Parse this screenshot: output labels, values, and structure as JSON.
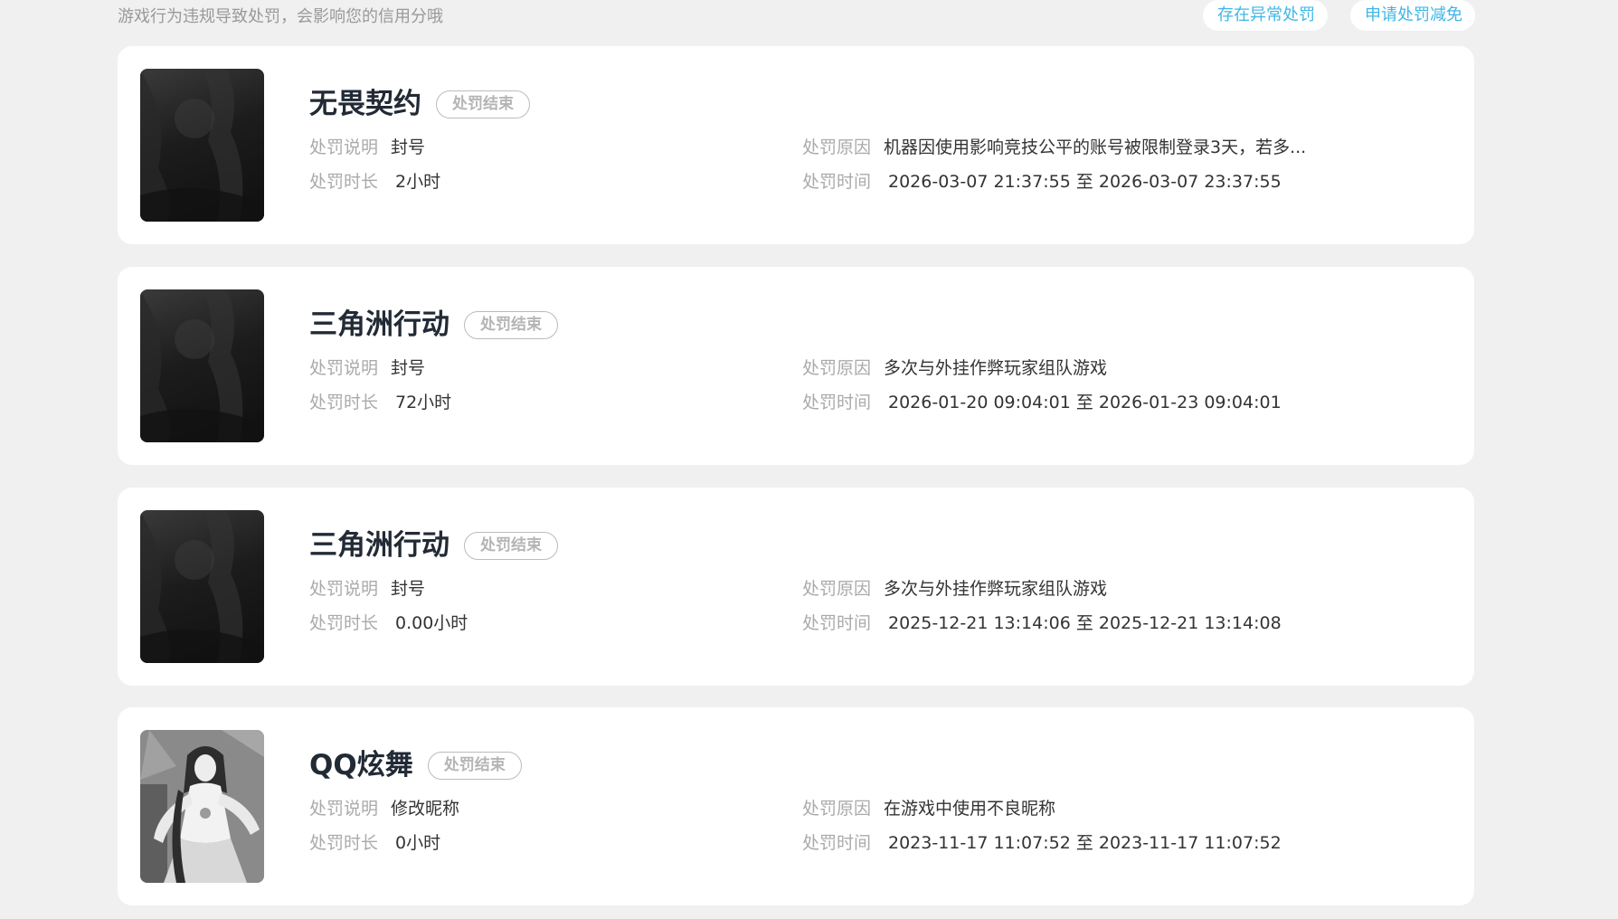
{
  "header": {
    "notice": "游戏行为违规导致处罚，会影响您的信用分哦",
    "abnormal_label": "存在异常处罚",
    "reduce_label": "申请处罚减免"
  },
  "labels": {
    "desc": "处罚说明",
    "duration": "处罚时长",
    "reason": "处罚原因",
    "time": "处罚时间"
  },
  "records": [
    {
      "game": "无畏契约",
      "status": "处罚结束",
      "desc": "封号",
      "duration": "2小时",
      "reason": "机器因使用影响竞技公平的账号被限制登录3天，若多...",
      "time": "2026-03-07 21:37:55 至 2026-03-07 23:37:55",
      "cover_icon": "game-cover-dark-icon"
    },
    {
      "game": "三角洲行动",
      "status": "处罚结束",
      "desc": "封号",
      "duration": "72小时",
      "reason": "多次与外挂作弊玩家组队游戏",
      "time": "2026-01-20 09:04:01 至 2026-01-23 09:04:01",
      "cover_icon": "game-cover-dark-icon"
    },
    {
      "game": "三角洲行动",
      "status": "处罚结束",
      "desc": "封号",
      "duration": "0.00小时",
      "reason": "多次与外挂作弊玩家组队游戏",
      "time": "2025-12-21 13:14:06 至 2025-12-21 13:14:08",
      "cover_icon": "game-cover-dark-icon"
    },
    {
      "game": "QQ炫舞",
      "status": "处罚结束",
      "desc": "修改昵称",
      "duration": "0小时",
      "reason": "在游戏中使用不良昵称",
      "time": "2023-11-17 11:07:52 至 2023-11-17 11:07:52",
      "cover_icon": "game-cover-dancer-icon"
    }
  ],
  "colors": {
    "background": "#f0f0f0",
    "card": "#ffffff",
    "accent": "#3db6e8",
    "label": "#aaaaaa",
    "value": "#333333",
    "title": "#222a35",
    "badge": "#b5b5b5"
  }
}
